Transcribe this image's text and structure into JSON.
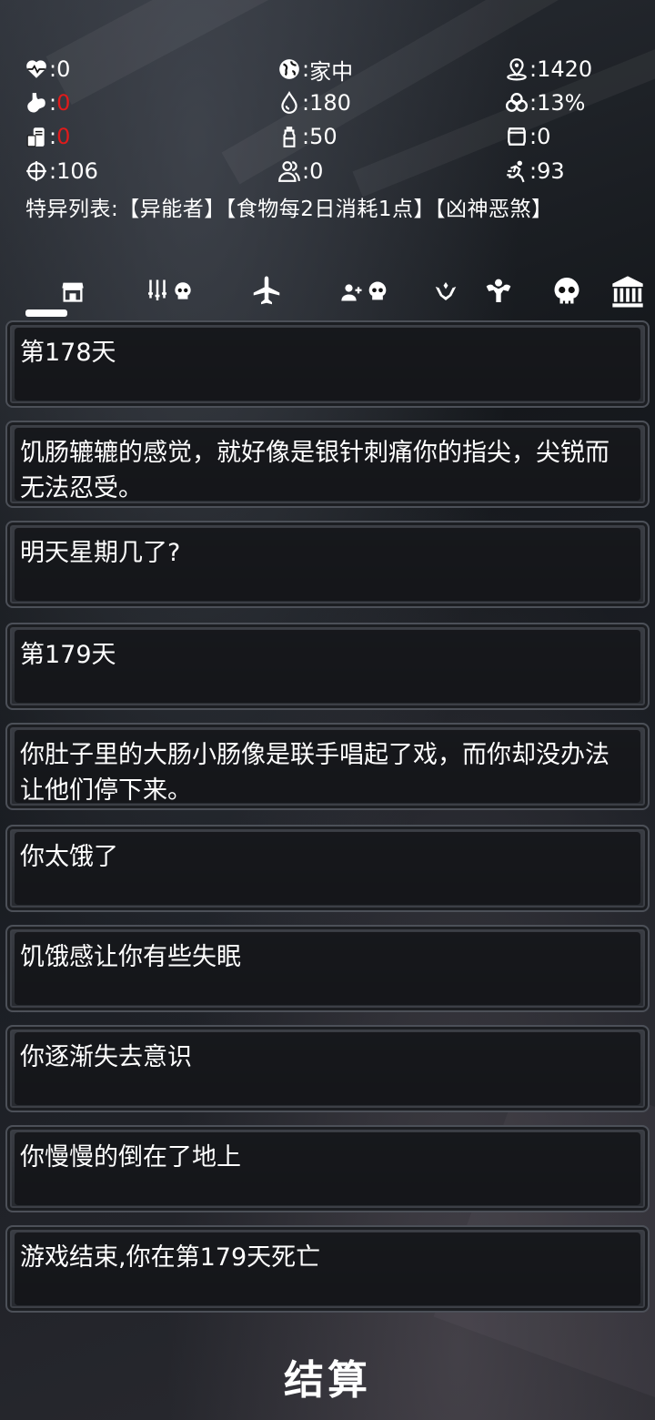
{
  "stats": {
    "health": "0",
    "location": "家中",
    "distance": "1420",
    "hunger": "0",
    "water": "180",
    "infection": "13%",
    "food_stock": "0",
    "bottle": "50",
    "armor": "0",
    "target": "106",
    "companions": "0",
    "speed": "93"
  },
  "status_colors": {
    "danger": "#e01b1b",
    "normal": "#ffffff"
  },
  "traits": {
    "label": "特异列表:",
    "items": [
      "【异能者】",
      "【食物每2日消耗1点】",
      "【凶神恶煞】"
    ]
  },
  "tabs": [
    "shop-icon",
    "weapons-skull-icon",
    "airplane-icon",
    "add-person-skull-icon",
    "hands-icon",
    "muscle-icon",
    "skull-icon",
    "bank-icon"
  ],
  "log": [
    "第178天",
    "饥肠辘辘的感觉，就好像是银针刺痛你的指尖，尖锐而无法忍受。",
    "明天星期几了?",
    "第179天",
    "你肚子里的大肠小肠像是联手唱起了戏，而你却没办法让他们停下来。",
    "你太饿了",
    "饥饿感让你有些失眠",
    "你逐渐失去意识",
    "你慢慢的倒在了地上",
    "游戏结束,你在第179天死亡"
  ],
  "settle_label": "结算"
}
